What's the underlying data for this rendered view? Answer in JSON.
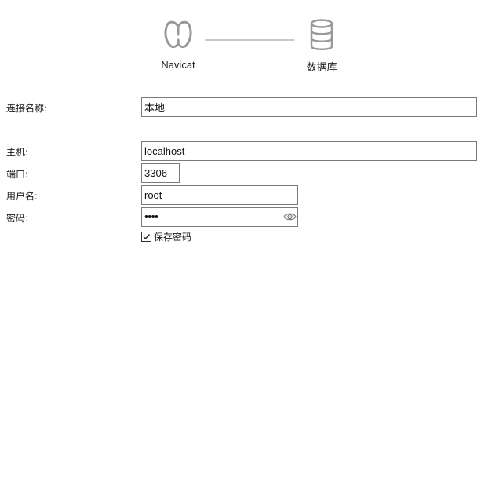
{
  "steps": {
    "navicat": {
      "label": "Navicat",
      "icon": "navicat-logo-icon"
    },
    "database": {
      "label": "数据库",
      "icon": "database-icon"
    }
  },
  "form": {
    "connection_name": {
      "label": "连接名称:",
      "value": "本地"
    },
    "host": {
      "label": "主机:",
      "value": "localhost"
    },
    "port": {
      "label": "端口:",
      "value": "3306"
    },
    "username": {
      "label": "用户名:",
      "value": "root"
    },
    "password": {
      "label": "密码:",
      "value": "••••",
      "reveal_icon": "eye-icon"
    },
    "save_password": {
      "label": "保存密码",
      "checked": true
    }
  },
  "colors": {
    "icon_gray": "#999999",
    "field_border": "#7a7a7a",
    "connector": "#c8c8c8"
  }
}
